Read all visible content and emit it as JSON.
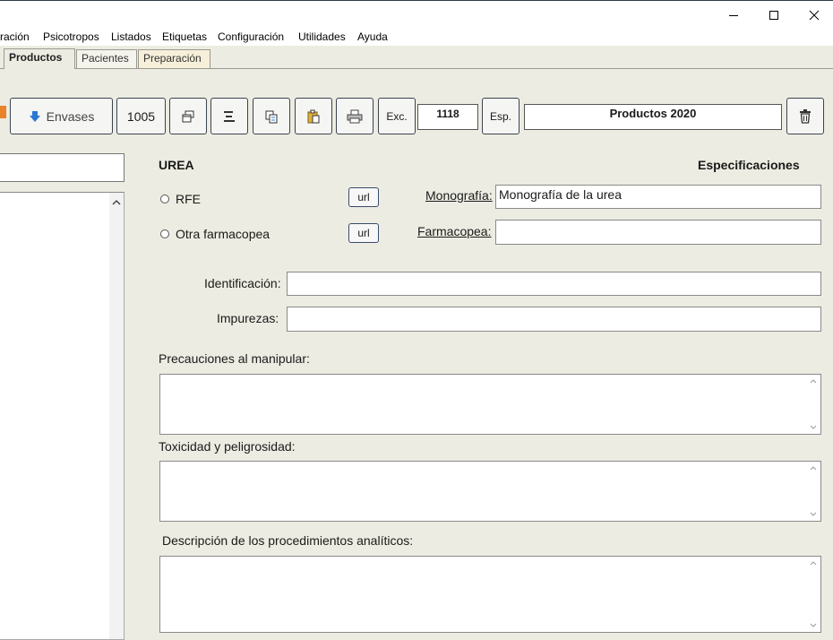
{
  "window": {
    "minimize_glyph": "—",
    "maximize_glyph": "☐",
    "close_glyph": "✕"
  },
  "menu": [
    "ración",
    "Psicotropos",
    "Listados",
    "Etiquetas",
    "Configuración",
    "Utilidades",
    "Ayuda"
  ],
  "tabs": {
    "products": "Productos",
    "patients": "Pacientes",
    "preparation": "Preparación"
  },
  "toolbar": {
    "envases_label": "Envases",
    "count_1005": "1005",
    "exc_label": "Exc.",
    "code_box": "1118",
    "esp_label": "Esp.",
    "title_box": "Productos 2020"
  },
  "form": {
    "product_name": "UREA",
    "spec_heading": "Especificaciones",
    "rfe_label": "RFE",
    "other_pharm_label": "Otra farmacopea",
    "url_label": "url",
    "monografia_label": "Monografía:",
    "monografia_value": "Monografía de la urea",
    "farmacopea_label": "Farmacopea:",
    "farmacopea_value": "",
    "identificacion_label": "Identificación:",
    "identificacion_value": "",
    "impurezas_label": "Impurezas:",
    "impurezas_value": "",
    "precauciones_label": "Precauciones al manipular:",
    "toxicidad_label": "Toxicidad y peligrosidad:",
    "descripcion_label": "Descripción de los procedimientos analíticos:"
  },
  "colors": {
    "background": "#ecece2",
    "border_dark": "#3b4350",
    "envases_arrow": "#2a78d6"
  }
}
